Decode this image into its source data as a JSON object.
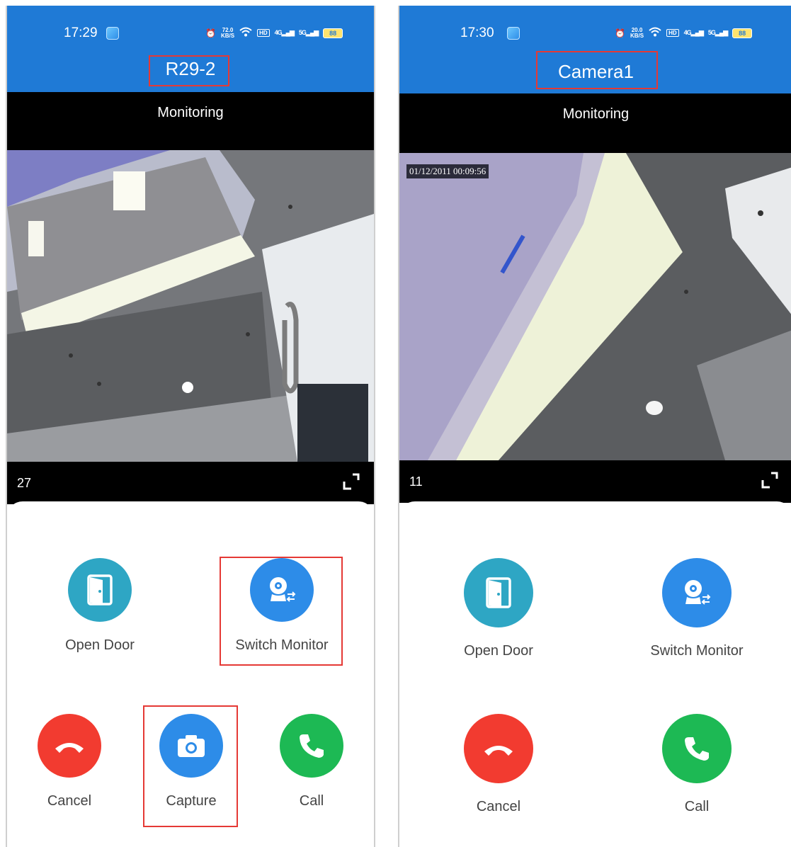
{
  "left_screen": {
    "status": {
      "time": "17:29",
      "net_speed": "72.0",
      "net_unit": "KB/S",
      "hd": "HD",
      "sig1": "4G",
      "sig2": "5G",
      "battery": "88"
    },
    "title": "R29-2",
    "subtitle": "Monitoring",
    "counter": "27",
    "buttons": {
      "open_door": "Open Door",
      "switch_monitor": "Switch Monitor",
      "cancel": "Cancel",
      "capture": "Capture",
      "call": "Call"
    }
  },
  "right_screen": {
    "status": {
      "time": "17:30",
      "net_speed": "20.0",
      "net_unit": "KB/S",
      "hd": "HD",
      "sig1": "4G",
      "sig2": "5G",
      "battery": "88"
    },
    "title": "Camera1",
    "subtitle": "Monitoring",
    "video_timestamp": "01/12/2011 00:09:56",
    "counter": "11",
    "buttons": {
      "open_door": "Open Door",
      "switch_monitor": "Switch Monitor",
      "cancel": "Cancel",
      "call": "Call"
    }
  },
  "colors": {
    "header_blue": "#1f7ad6",
    "open_door_teal": "#2ea6c4",
    "switch_blue": "#2d8ce8",
    "cancel_red": "#f23b30",
    "call_green": "#1db954",
    "highlight_red": "#e53935"
  },
  "icons": [
    "alarm-icon",
    "wifi-icon",
    "door-icon",
    "switch-monitor-icon",
    "hangup-icon",
    "camera-icon",
    "phone-icon",
    "fullscreen-icon"
  ]
}
